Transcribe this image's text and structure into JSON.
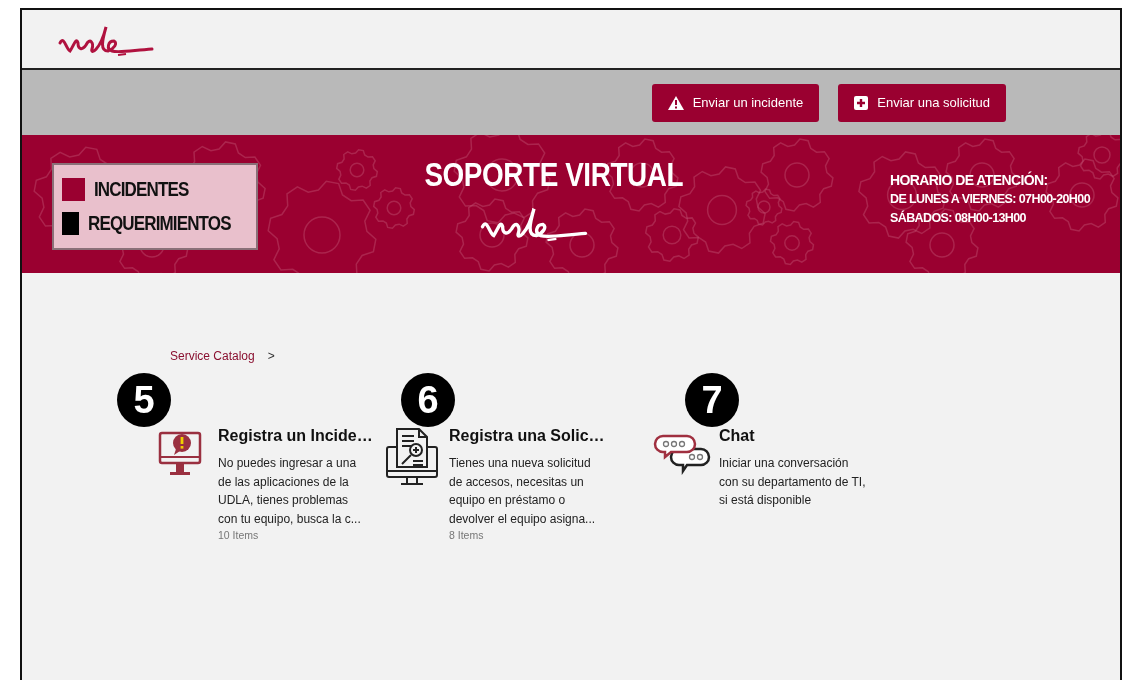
{
  "action_bar": {
    "buttons": [
      {
        "label": "Enviar un incidente",
        "kind": "warning"
      },
      {
        "label": "Enviar una solicitud",
        "kind": "add"
      }
    ]
  },
  "banner": {
    "legend": [
      {
        "label": "INCIDENTES",
        "color": "#9a0030"
      },
      {
        "label": "REQUERIMIENTOS",
        "color": "#000000"
      }
    ],
    "title": "SOPORTE VIRTUAL",
    "schedule": [
      "HORARIO DE ATENCIÓN:",
      "DE LUNES A VIERNES: 07H00-20H00",
      "SÁBADOS: 08H00-13H00"
    ]
  },
  "breadcrumb": {
    "link": "Service Catalog",
    "separator": ">"
  },
  "cards": [
    {
      "kind": "incident",
      "badge": "5",
      "title": "Registra un Incide…",
      "description": "No puedes ingresar a una de las aplicaciones de la UDLA, tienes problemas con tu equipo, busca la c...",
      "count": "10 Items"
    },
    {
      "kind": "request",
      "badge": "6",
      "title": "Registra una Solic…",
      "description": "Tienes una nueva solicitud de accesos, necesitas un equipo en préstamo o devolver el equipo asigna...",
      "count": "8 Items"
    },
    {
      "kind": "chat",
      "badge": "7",
      "title": "Chat",
      "description": "Iniciar una conversación con su departamento de TI, si está disponible"
    }
  ]
}
